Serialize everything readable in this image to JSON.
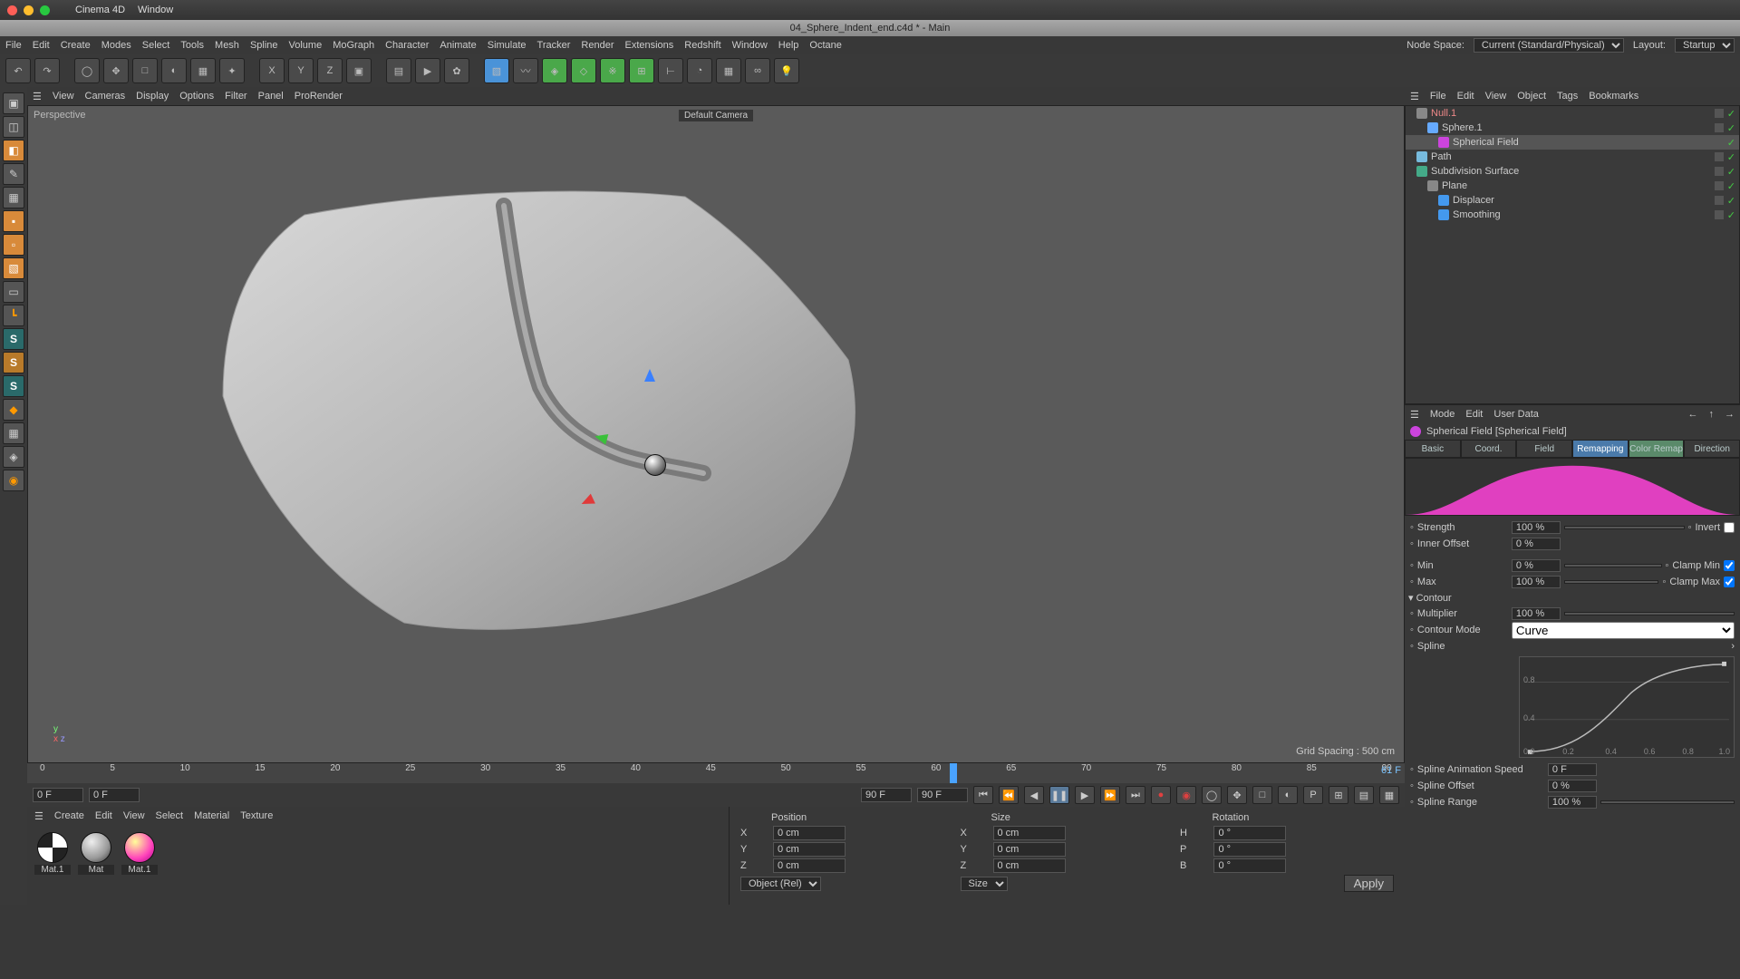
{
  "mac_menu": {
    "app": "Cinema 4D",
    "items": [
      "Window"
    ]
  },
  "title_bar": "04_Sphere_Indent_end.c4d * - Main",
  "top_menu": [
    "File",
    "Edit",
    "Create",
    "Modes",
    "Select",
    "Tools",
    "Mesh",
    "Spline",
    "Volume",
    "MoGraph",
    "Character",
    "Animate",
    "Simulate",
    "Tracker",
    "Render",
    "Extensions",
    "Redshift",
    "Window",
    "Help",
    "Octane"
  ],
  "node_space": {
    "label": "Node Space:",
    "value": "Current (Standard/Physical)"
  },
  "layout": {
    "label": "Layout:",
    "value": "Startup"
  },
  "viewport_menu": [
    "View",
    "Cameras",
    "Display",
    "Options",
    "Filter",
    "Panel",
    "ProRender"
  ],
  "viewport": {
    "label": "Perspective",
    "camera": "Default Camera",
    "grid": "Grid Spacing : 500 cm"
  },
  "timeline": {
    "ticks": [
      "0",
      "5",
      "10",
      "15",
      "20",
      "25",
      "30",
      "35",
      "40",
      "45",
      "50",
      "55",
      "60",
      "65",
      "70",
      "75",
      "80",
      "85",
      "90"
    ],
    "frame": "61 F",
    "start": "0 F",
    "end": "0 F",
    "range_start": "90 F",
    "range_end": "90 F"
  },
  "material_menu": [
    "Create",
    "Edit",
    "View",
    "Select",
    "Material",
    "Texture"
  ],
  "materials": [
    {
      "name": "Mat.1"
    },
    {
      "name": "Mat"
    },
    {
      "name": "Mat.1"
    }
  ],
  "coord": {
    "headers": [
      "Position",
      "Size",
      "Rotation"
    ],
    "rows": [
      {
        "a": "X",
        "av": "0 cm",
        "b": "X",
        "bv": "0 cm",
        "c": "H",
        "cv": "0 °"
      },
      {
        "a": "Y",
        "av": "0 cm",
        "b": "Y",
        "bv": "0 cm",
        "c": "P",
        "cv": "0 °"
      },
      {
        "a": "Z",
        "av": "0 cm",
        "b": "Z",
        "bv": "0 cm",
        "c": "B",
        "cv": "0 °"
      }
    ],
    "mode1": "Object (Rel)",
    "mode2": "Size",
    "apply": "Apply"
  },
  "obj_menu": [
    "File",
    "Edit",
    "View",
    "Object",
    "Tags",
    "Bookmarks"
  ],
  "obj_tree": [
    {
      "pad": 12,
      "cls": "null",
      "name": "Null.1",
      "ico": "#888"
    },
    {
      "pad": 24,
      "cls": "",
      "name": "Sphere.1",
      "ico": "#6af"
    },
    {
      "pad": 36,
      "cls": "sel",
      "name": "Spherical Field",
      "ico": "#c4d"
    },
    {
      "pad": 12,
      "cls": "",
      "name": "Path",
      "ico": "#7bd"
    },
    {
      "pad": 12,
      "cls": "",
      "name": "Subdivision Surface",
      "ico": "#4a8"
    },
    {
      "pad": 24,
      "cls": "",
      "name": "Plane",
      "ico": "#888"
    },
    {
      "pad": 36,
      "cls": "",
      "name": "Displacer",
      "ico": "#49e"
    },
    {
      "pad": 36,
      "cls": "",
      "name": "Smoothing",
      "ico": "#49e"
    }
  ],
  "attr_menu": [
    "Mode",
    "Edit",
    "User Data"
  ],
  "attr_title": "Spherical Field [Spherical Field]",
  "attr_tabs": [
    "Basic",
    "Coord.",
    "Field",
    "Remapping",
    "Color Remap",
    "Direction"
  ],
  "remap": {
    "strength": {
      "label": "Strength",
      "value": "100 %"
    },
    "invert": {
      "label": "Invert"
    },
    "inner_offset": {
      "label": "Inner Offset",
      "value": "0 %"
    },
    "min": {
      "label": "Min",
      "value": "0 %"
    },
    "clamp_min": {
      "label": "Clamp Min"
    },
    "max": {
      "label": "Max",
      "value": "100 %"
    },
    "clamp_max": {
      "label": "Clamp Max"
    },
    "contour": "Contour",
    "multiplier": {
      "label": "Multiplier",
      "value": "100 %"
    },
    "contour_mode": {
      "label": "Contour Mode",
      "value": "Curve"
    },
    "spline": {
      "label": "Spline"
    },
    "anim_speed": {
      "label": "Spline Animation Speed",
      "value": "0 F"
    },
    "offset": {
      "label": "Spline Offset",
      "value": "0 %"
    },
    "range": {
      "label": "Spline Range",
      "value": "100 %"
    }
  },
  "spline_ticks": {
    "y": [
      "0.8",
      "0.4"
    ],
    "x": [
      "0.0",
      "0.2",
      "0.4",
      "0.6",
      "0.8",
      "1.0"
    ]
  }
}
